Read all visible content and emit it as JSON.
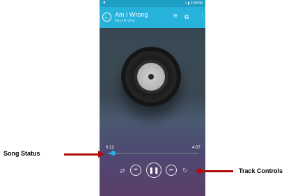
{
  "status_bar": {
    "time": "2:34",
    "ampm": "PM",
    "indicator_icon": "notification-icon"
  },
  "app_bar": {
    "title": "Am I Wrong",
    "subtitle": "Nico & Vinz",
    "back_icon": "back-icon",
    "list_icon": "list-icon",
    "queue_icon": "queue-icon",
    "more_icon": "more-icon"
  },
  "player": {
    "current_time": "0:12",
    "total_time": "4:07",
    "progress": 0.05
  },
  "controls": {
    "shuffle_icon": "shuffle-icon",
    "prev_icon": "previous-icon",
    "play_icon": "pause-icon",
    "next_icon": "next-icon",
    "repeat_icon": "repeat-icon"
  },
  "annotations": {
    "left_label": "Song Status",
    "right_label": "Track Controls"
  },
  "colors": {
    "accent": "#27b2dc",
    "annotation_arrow": "#b10a0a"
  }
}
